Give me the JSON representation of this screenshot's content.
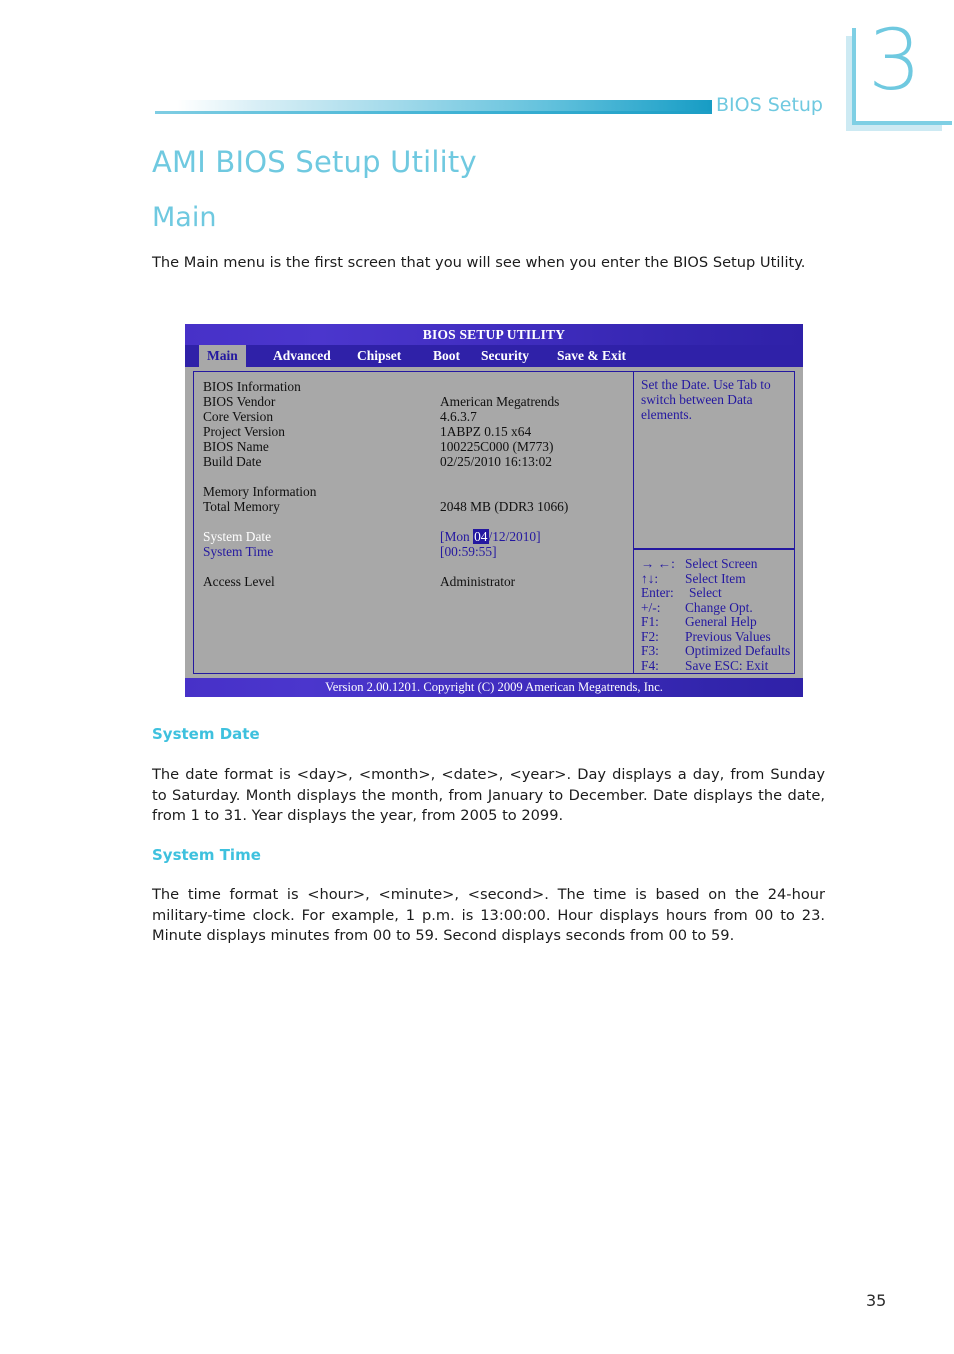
{
  "page": {
    "chapter_number": "3",
    "header_label": "BIOS Setup",
    "page_number": "35",
    "title": "AMI BIOS Setup Utility",
    "section": "Main",
    "intro": "The Main menu is the first screen that you will see when you enter the BIOS Setup Utility."
  },
  "bios": {
    "window_title": "BIOS SETUP UTILITY",
    "tabs": [
      {
        "label": "Main",
        "selected": true
      },
      {
        "label": "Advanced",
        "selected": false
      },
      {
        "label": "Chipset",
        "selected": false
      },
      {
        "label": "Boot",
        "selected": false
      },
      {
        "label": "Security",
        "selected": false
      },
      {
        "label": "Save & Exit",
        "selected": false
      }
    ],
    "rows": [
      {
        "label": "BIOS Information",
        "value": ""
      },
      {
        "label": "BIOS Vendor",
        "value": "American Megatrends"
      },
      {
        "label": "Core Version",
        "value": "4.6.3.7"
      },
      {
        "label": "Project Version",
        "value": "1ABPZ 0.15 x64"
      },
      {
        "label": "BIOS Name",
        "value": "100225C000 (M773)"
      },
      {
        "label": "Build Date",
        "value": "02/25/2010 16:13:02"
      },
      {
        "label": "Memory Information",
        "value": ""
      },
      {
        "label": "Total Memory",
        "value": "2048 MB (DDR3 1066)"
      },
      {
        "label": "Access Level",
        "value": "Administrator"
      }
    ],
    "system_date": {
      "label": "System Date",
      "value_prefix": "[Mon ",
      "value_highlight": "04",
      "value_suffix": "/12/2010]"
    },
    "system_time": {
      "label": "System Time",
      "value": "[00:59:55]"
    },
    "help_text": "Set the Date. Use Tab to switch between Data elements.",
    "keys": [
      {
        "key": "→ ←:",
        "desc": "Select Screen"
      },
      {
        "key": "↑↓:",
        "desc": "Select Item"
      },
      {
        "key": "Enter:",
        "desc": "Select"
      },
      {
        "key": "+/-:",
        "desc": "Change Opt."
      },
      {
        "key": "F1:",
        "desc": "General Help"
      },
      {
        "key": "F2:",
        "desc": "Previous Values"
      },
      {
        "key": "F3:",
        "desc": "Optimized Defaults"
      },
      {
        "key": "F4:",
        "desc": "Save   ESC: Exit"
      }
    ],
    "footer": "Version 2.00.1201. Copyright (C) 2009 American Megatrends, Inc."
  },
  "sections": {
    "system_date": {
      "heading": "System Date",
      "body": "The date format is <day>, <month>, <date>, <year>. Day displays a day, from Sunday to Saturday. Month displays the month, from January to December. Date displays the date, from 1 to 31. Year displays the year, from 2005 to 2099."
    },
    "system_time": {
      "heading": "System Time",
      "body": "The time format is <hour>, <minute>, <second>. The time is based on the 24-hour military-time clock. For example, 1 p.m. is 13:00:00. Hour displays hours from 00 to 23. Minute displays minutes from 00 to 59. Second displays seconds from 00 to 59."
    }
  },
  "colors": {
    "accent": "#6fc9e0",
    "bios_blue": "#2418a0",
    "bios_gray": "#a8a8a8"
  }
}
